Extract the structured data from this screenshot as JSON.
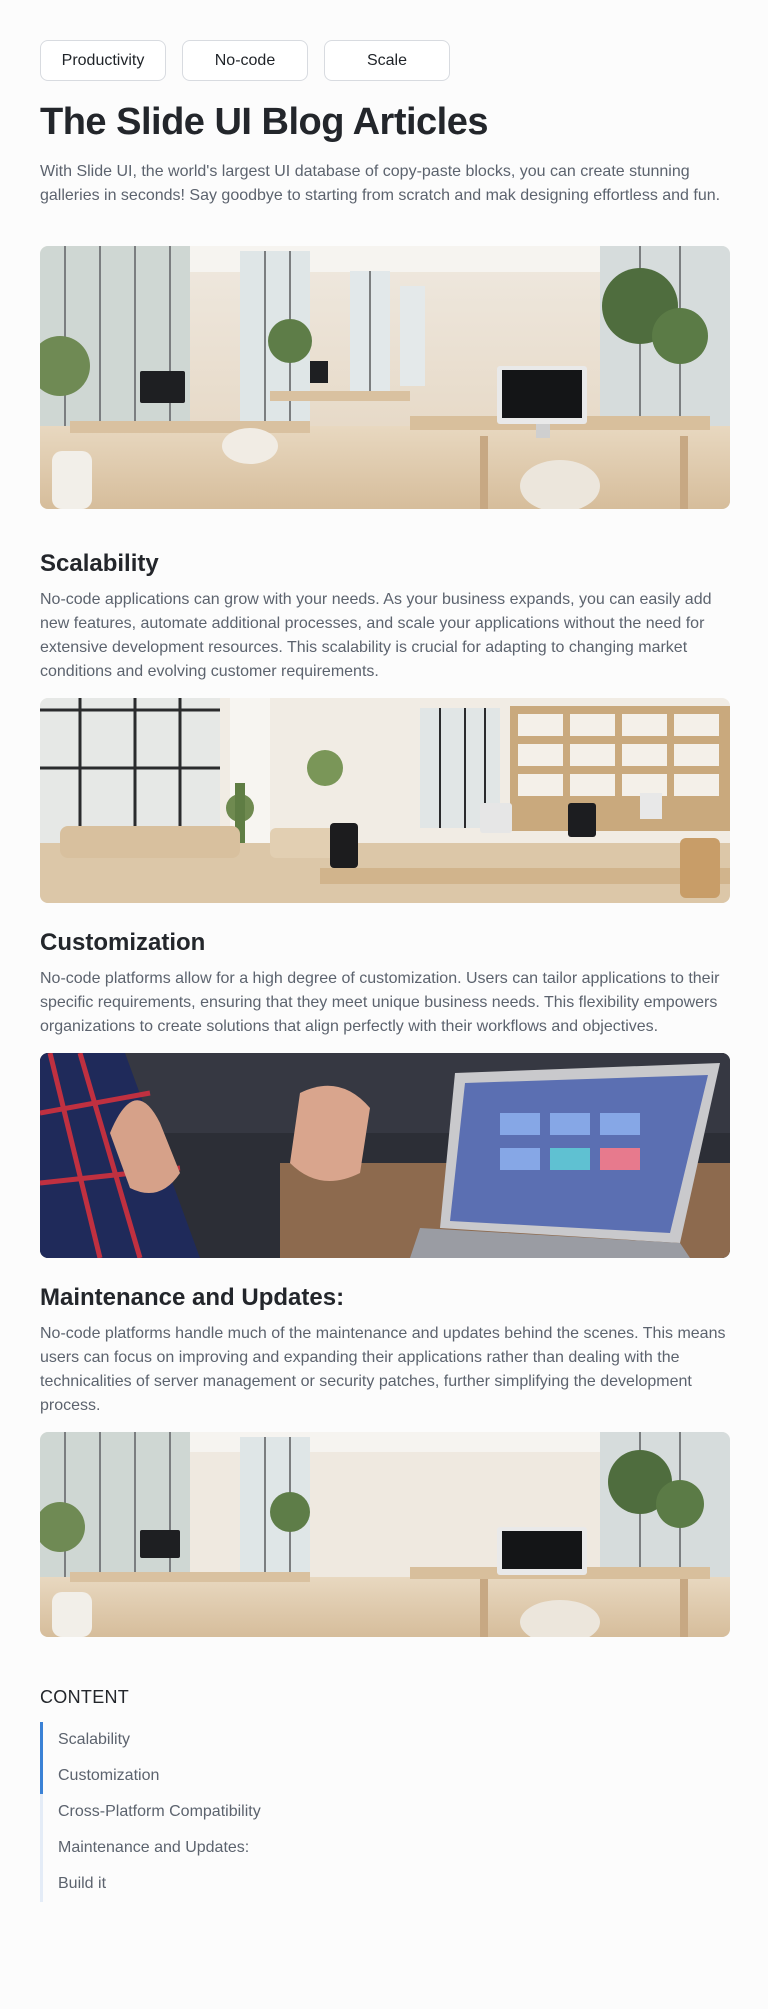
{
  "tags": [
    "Productivity",
    "No-code",
    "Scale"
  ],
  "header": {
    "title": "The Slide UI Blog Articles",
    "intro": "With Slide UI, the world's largest UI database of copy-paste blocks, you can create stunning galleries in seconds! Say goodbye to starting from scratch and mak designing effortless and fun."
  },
  "sections": [
    {
      "title": "Scalability",
      "body": "No-code applications can grow with your needs. As your business expands, you can easily add new features, automate additional processes, and scale your applications without the need for extensive development resources. This scalability is crucial for adapting to changing market conditions and evolving customer requirements."
    },
    {
      "title": "Customization",
      "body": "No-code platforms allow for a high degree of customization. Users can tailor applications to their specific requirements, ensuring that they meet unique business needs. This flexibility empowers organizations to create solutions that align perfectly with their workflows and objectives."
    },
    {
      "title": "Maintenance and Updates:",
      "body": "No-code platforms handle much of the maintenance and updates behind the scenes. This means users can focus on improving and expanding their applications rather than dealing with the technicalities of server management or security patches, further simplifying the development process."
    }
  ],
  "toc": {
    "heading": "CONTENT",
    "items": [
      "Scalability",
      "Customization",
      "Cross-Platform Compatibility",
      "Maintenance and Updates:",
      "Build it"
    ]
  },
  "colors": {
    "accent": "#3b82d6",
    "text": "#23262b",
    "muted": "#5c636e"
  }
}
